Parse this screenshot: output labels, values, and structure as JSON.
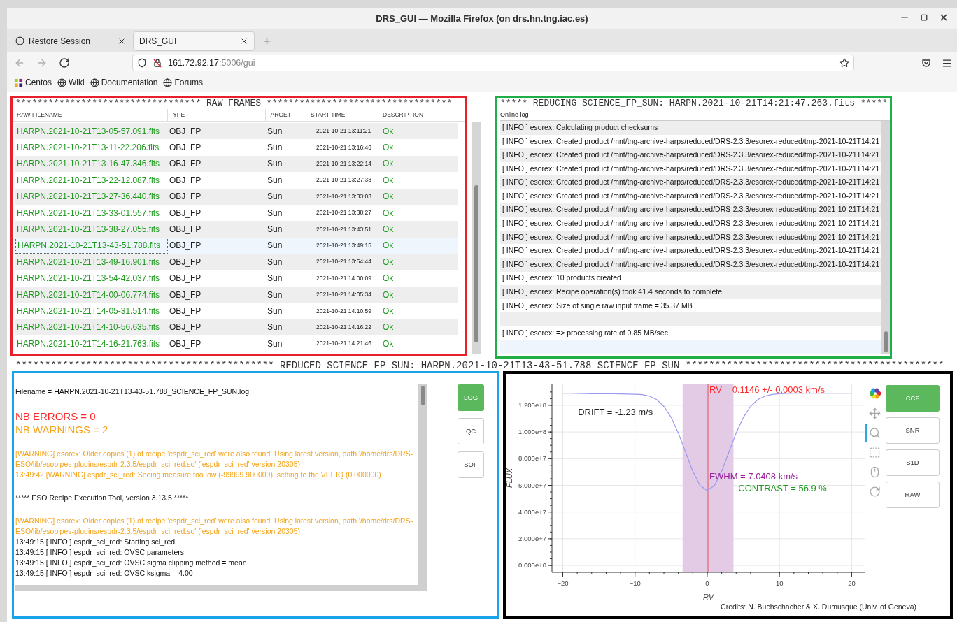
{
  "window": {
    "title": "DRS_GUI — Mozilla Firefox (on drs.hn.tng.iac.es)"
  },
  "tabs": [
    {
      "label": "Restore Session",
      "kind": "info",
      "selected": false
    },
    {
      "label": "DRS_GUI",
      "kind": "page",
      "selected": true
    }
  ],
  "nav_buttons": [
    {
      "kind": "back",
      "disabled": true
    },
    {
      "kind": "forward",
      "disabled": true
    },
    {
      "kind": "reload",
      "disabled": false
    }
  ],
  "address_bar": {
    "host": "161.72.92.17",
    "path": ":5006/gui"
  },
  "bookmarks": [
    {
      "label": "Centos",
      "kind": "distro"
    },
    {
      "label": "Wiki",
      "kind": "globe"
    },
    {
      "label": "Documentation",
      "kind": "globe"
    },
    {
      "label": "Forums",
      "kind": "globe"
    }
  ],
  "raw_frames": {
    "frame": {
      "color": "#e8202a"
    },
    "header": "********************************** RAW FRAMES **********************************",
    "columns": [
      "RAW FILENAME",
      "TYPE",
      "TARGET",
      "START TIME",
      "DESCRIPTION"
    ],
    "rows": [
      {
        "filename": "HARPN.2021-10-21T13-05-57.091.fits",
        "type": "OBJ_FP",
        "target": "Sun",
        "start_time": "2021-10-21 13:11:21",
        "description": "Ok",
        "selected": false
      },
      {
        "filename": "HARPN.2021-10-21T13-11-22.206.fits",
        "type": "OBJ_FP",
        "target": "Sun",
        "start_time": "2021-10-21 13:16:46",
        "description": "Ok",
        "selected": false
      },
      {
        "filename": "HARPN.2021-10-21T13-16-47.346.fits",
        "type": "OBJ_FP",
        "target": "Sun",
        "start_time": "2021-10-21 13:22:14",
        "description": "Ok",
        "selected": false
      },
      {
        "filename": "HARPN.2021-10-21T13-22-12.087.fits",
        "type": "OBJ_FP",
        "target": "Sun",
        "start_time": "2021-10-21 13:27:38",
        "description": "Ok",
        "selected": false
      },
      {
        "filename": "HARPN.2021-10-21T13-27-36.440.fits",
        "type": "OBJ_FP",
        "target": "Sun",
        "start_time": "2021-10-21 13:33:03",
        "description": "Ok",
        "selected": false
      },
      {
        "filename": "HARPN.2021-10-21T13-33-01.557.fits",
        "type": "OBJ_FP",
        "target": "Sun",
        "start_time": "2021-10-21 13:38:27",
        "description": "Ok",
        "selected": false
      },
      {
        "filename": "HARPN.2021-10-21T13-38-27.055.fits",
        "type": "OBJ_FP",
        "target": "Sun",
        "start_time": "2021-10-21 13:43:51",
        "description": "Ok",
        "selected": false
      },
      {
        "filename": "HARPN.2021-10-21T13-43-51.788.fits",
        "type": "OBJ_FP",
        "target": "Sun",
        "start_time": "2021-10-21 13:49:15",
        "description": "Ok",
        "selected": true
      },
      {
        "filename": "HARPN.2021-10-21T13-49-16.901.fits",
        "type": "OBJ_FP",
        "target": "Sun",
        "start_time": "2021-10-21 13:54:44",
        "description": "Ok",
        "selected": false
      },
      {
        "filename": "HARPN.2021-10-21T13-54-42.037.fits",
        "type": "OBJ_FP",
        "target": "Sun",
        "start_time": "2021-10-21 14:00:09",
        "description": "Ok",
        "selected": false
      },
      {
        "filename": "HARPN.2021-10-21T14-00-06.774.fits",
        "type": "OBJ_FP",
        "target": "Sun",
        "start_time": "2021-10-21 14:05:34",
        "description": "Ok",
        "selected": false
      },
      {
        "filename": "HARPN.2021-10-21T14-05-31.514.fits",
        "type": "OBJ_FP",
        "target": "Sun",
        "start_time": "2021-10-21 14:10:59",
        "description": "Ok",
        "selected": false
      },
      {
        "filename": "HARPN.2021-10-21T14-10-56.635.fits",
        "type": "OBJ_FP",
        "target": "Sun",
        "start_time": "2021-10-21 14:16:22",
        "description": "Ok",
        "selected": false
      },
      {
        "filename": "HARPN.2021-10-21T14-16-21.763.fits",
        "type": "OBJ_FP",
        "target": "Sun",
        "start_time": "2021-10-21 14:21:46",
        "description": "Ok",
        "selected": false
      }
    ]
  },
  "online_log": {
    "frame": {
      "color": "#1fae47"
    },
    "header": "***** REDUCING SCIENCE_FP_SUN: HARPN.2021-10-21T14:21:47.263.fits *****",
    "label": "Online log",
    "rows": [
      {
        "kind": "entry",
        "text": "[ INFO ] esorex: Calculating product checksums",
        "selected": false
      },
      {
        "kind": "entry",
        "text": "[ INFO ] esorex: Created product /mnt/tng-archive-harps/reduced/DRS-2.3.3/esorex-reduced/tmp-2021-10-21T14:21",
        "selected": false
      },
      {
        "kind": "entry",
        "text": "[ INFO ] esorex: Created product /mnt/tng-archive-harps/reduced/DRS-2.3.3/esorex-reduced/tmp-2021-10-21T14:21",
        "selected": false
      },
      {
        "kind": "entry",
        "text": "[ INFO ] esorex: Created product /mnt/tng-archive-harps/reduced/DRS-2.3.3/esorex-reduced/tmp-2021-10-21T14:21",
        "selected": false
      },
      {
        "kind": "entry",
        "text": "[ INFO ] esorex: Created product /mnt/tng-archive-harps/reduced/DRS-2.3.3/esorex-reduced/tmp-2021-10-21T14:21",
        "selected": false
      },
      {
        "kind": "entry",
        "text": "[ INFO ] esorex: Created product /mnt/tng-archive-harps/reduced/DRS-2.3.3/esorex-reduced/tmp-2021-10-21T14:21",
        "selected": false
      },
      {
        "kind": "entry",
        "text": "[ INFO ] esorex: Created product /mnt/tng-archive-harps/reduced/DRS-2.3.3/esorex-reduced/tmp-2021-10-21T14:21",
        "selected": false
      },
      {
        "kind": "entry",
        "text": "[ INFO ] esorex: Created product /mnt/tng-archive-harps/reduced/DRS-2.3.3/esorex-reduced/tmp-2021-10-21T14:21",
        "selected": false
      },
      {
        "kind": "entry",
        "text": "[ INFO ] esorex: Created product /mnt/tng-archive-harps/reduced/DRS-2.3.3/esorex-reduced/tmp-2021-10-21T14:21",
        "selected": false
      },
      {
        "kind": "entry",
        "text": "[ INFO ] esorex: Created product /mnt/tng-archive-harps/reduced/DRS-2.3.3/esorex-reduced/tmp-2021-10-21T14:21",
        "selected": false
      },
      {
        "kind": "entry",
        "text": "[ INFO ] esorex: Created product /mnt/tng-archive-harps/reduced/DRS-2.3.3/esorex-reduced/tmp-2021-10-21T14:21",
        "selected": false
      },
      {
        "kind": "entry",
        "text": "[ INFO ] esorex: 10 products created",
        "selected": false
      },
      {
        "kind": "entry",
        "text": "[ INFO ] esorex: Recipe operation(s) took 41.4 seconds to complete.",
        "selected": false
      },
      {
        "kind": "entry",
        "text": "[ INFO ] esorex: Size of single raw input frame = 35.37 MB",
        "selected": false
      },
      {
        "kind": "blank",
        "selected": false
      },
      {
        "kind": "entry",
        "text": "[ INFO ] esorex: => processing rate of 0.85 MB/sec",
        "selected": false
      },
      {
        "kind": "blank",
        "selected": true
      }
    ]
  },
  "section_header": "******************************************** REDUCED SCIENCE FP SUN: HARPN.2021-10-21T13-43-51.788 SCIENCE FP SUN ********************************************",
  "reduced_log": {
    "frame": {
      "color": "#1aa3e8"
    },
    "blocks": [
      [
        {
          "kind": "plain",
          "text": "Filename = HARPN.2021-10-21T13-43-51.788_SCIENCE_FP_SUN.log"
        }
      ],
      [
        {
          "kind": "error_count",
          "text": "NB ERRORS = 0"
        },
        {
          "kind": "warning_count",
          "text": "NB WARNINGS = 2"
        }
      ],
      [
        {
          "kind": "warning",
          "text": "[WARNING] esorex: Older copies (1) of recipe 'espdr_sci_red' were also found. Using latest version, path '/home/drs/DRS-ESO/lib/esopipes-plugins/espdr-2.3.5/espdr_sci_red.so' ('espdr_sci_red' version 20305)"
        },
        {
          "kind": "warning",
          "text": "13:49:42 [WARNING] espdr_sci_red: Seeing measure too low (-99999.900000), setting to the VLT IQ (0.000000)"
        }
      ],
      [
        {
          "kind": "plain",
          "text": "***** ESO Recipe Execution Tool, version 3.13.5 *****"
        }
      ],
      [
        {
          "kind": "warning",
          "text": "[WARNING] esorex: Older copies (1) of recipe 'espdr_sci_red' were also found. Using latest version, path '/home/drs/DRS-ESO/lib/esopipes-plugins/espdr-2.3.5/espdr_sci_red.so' ('espdr_sci_red' version 20305)"
        },
        {
          "kind": "plain",
          "text": "13:49:15 [ INFO ] espdr_sci_red: Starting sci_red"
        },
        {
          "kind": "plain",
          "text": "13:49:15 [ INFO ] espdr_sci_red: OVSC parameters:"
        },
        {
          "kind": "plain",
          "text": "13:49:15 [ INFO ] espdr_sci_red: OVSC sigma clipping method = mean"
        },
        {
          "kind": "plain",
          "text": "13:49:15 [ INFO ] espdr_sci_red: OVSC ksigma = 4.00"
        }
      ]
    ],
    "buttons": [
      {
        "label": "LOG",
        "selected": true
      },
      {
        "label": "QC",
        "selected": false
      },
      {
        "label": "SOF",
        "selected": false
      }
    ]
  },
  "ccf": {
    "frame": {
      "color": "#000000"
    },
    "chart_data": {
      "type": "line",
      "xlabel": "RV",
      "ylabel": "FLUX",
      "x": [
        -20,
        -19,
        -18,
        -17,
        -16,
        -15,
        -14,
        -13,
        -12,
        -11,
        -10,
        -9,
        -8,
        -7,
        -6,
        -5,
        -4,
        -3,
        -2,
        -1,
        0,
        1,
        2,
        3,
        4,
        5,
        6,
        7,
        8,
        9,
        10,
        11,
        12,
        13,
        14,
        15,
        16,
        17,
        18,
        19,
        20
      ],
      "series": [
        {
          "color": "#9a9af0",
          "values": [
            129000000,
            129000000,
            128900000,
            128800000,
            128700000,
            128600000,
            128600000,
            128600000,
            128500000,
            128400000,
            128300000,
            128000000,
            126900000,
            124300000,
            119200000,
            111000000,
            99200000,
            84900000,
            70600000,
            60000000,
            56000000,
            60000000,
            70600000,
            84900000,
            99200000,
            111000000,
            119200000,
            124300000,
            126900000,
            128200000,
            128700000,
            128900000,
            129000000,
            129000000,
            129000000,
            129000000,
            129000000,
            129000000,
            129000000,
            129000000,
            129000000
          ]
        }
      ],
      "xlim": [
        -21.5,
        21.8
      ],
      "ylim": [
        -5200000,
        136200000
      ],
      "xticks": [
        {
          "value": -20,
          "label": "−20"
        },
        {
          "value": -10,
          "label": "−10"
        },
        {
          "value": 0,
          "label": "0"
        },
        {
          "value": 10,
          "label": "10"
        },
        {
          "value": 20,
          "label": "20"
        }
      ],
      "yticks": [
        {
          "value": 0,
          "label": "0.000e+0"
        },
        {
          "value": 20000000,
          "label": "2.000e+7"
        },
        {
          "value": 40000000,
          "label": "4.000e+7"
        },
        {
          "value": 60000000,
          "label": "6.000e+7"
        },
        {
          "value": 80000000,
          "label": "8.000e+7"
        },
        {
          "value": 100000000,
          "label": "1.000e+8"
        },
        {
          "value": 120000000,
          "label": "1.200e+8"
        }
      ],
      "grid": true,
      "bands": [
        {
          "axis": "x",
          "from": -3.41,
          "to": 3.63,
          "color": "#e3cbe5"
        }
      ],
      "ref_lines": [
        {
          "axis": "x",
          "value": 0.11,
          "color": "#e48a9a"
        }
      ],
      "annotations": [
        "RV = 0.1146 +/- 0.0003 km/s",
        "DRIFT = -1.23 m/s",
        "FWHM = 7.0408 km/s",
        "CONTRAST = 56.9 %"
      ]
    },
    "tools": [
      {
        "kind": "logo",
        "active": false
      },
      {
        "kind": "pan",
        "active": false
      },
      {
        "kind": "box_zoom",
        "active": true
      },
      {
        "kind": "box_select",
        "active": false
      },
      {
        "kind": "wheel_zoom",
        "active": false
      },
      {
        "kind": "reset",
        "active": false
      }
    ],
    "buttons": [
      {
        "label": "CCF",
        "selected": true
      },
      {
        "label": "SNR",
        "selected": false
      },
      {
        "label": "S1D",
        "selected": false
      },
      {
        "label": "RAW",
        "selected": false
      }
    ],
    "credits": "Credits: N. Buchschacher & X. Dumusque (Univ. of Geneva)"
  }
}
